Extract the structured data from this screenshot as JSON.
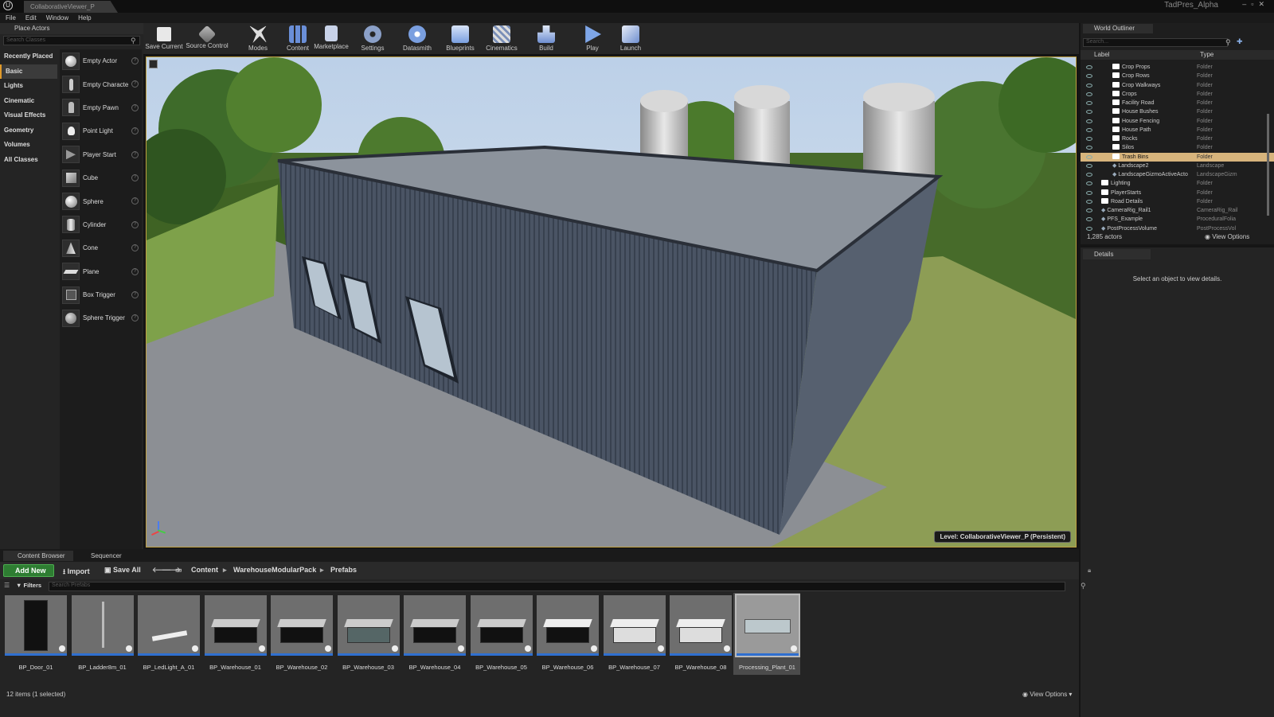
{
  "app": {
    "tab_title": "CollaborativeViewer_P",
    "project_name": "TadPres_Alpha"
  },
  "menu": [
    "File",
    "Edit",
    "Window",
    "Help"
  ],
  "place_actors": {
    "title": "Place Actors",
    "search_placeholder": "Search Classes",
    "categories": [
      "Recently Placed",
      "Basic",
      "Lights",
      "Cinematic",
      "Visual Effects",
      "Geometry",
      "Volumes",
      "All Classes"
    ],
    "selected_category": "Basic",
    "items": [
      "Empty Actor",
      "Empty Characte",
      "Empty Pawn",
      "Point Light",
      "Player Start",
      "Cube",
      "Sphere",
      "Cylinder",
      "Cone",
      "Plane",
      "Box Trigger",
      "Sphere Trigger"
    ]
  },
  "toolbar": {
    "buttons": [
      "Save Current",
      "Source Control",
      "Modes",
      "Content",
      "Marketplace",
      "Settings",
      "Datasmith",
      "Blueprints",
      "Cinematics",
      "Build",
      "Play",
      "Launch"
    ]
  },
  "viewport": {
    "level_label": "Level:  CollaborativeViewer_P (Persistent)"
  },
  "outliner": {
    "title": "World Outliner",
    "search_placeholder": "Search...",
    "col_label": "Label",
    "col_type": "Type",
    "rows": [
      {
        "name": "Crop Props",
        "type": "Folder",
        "indent": 2,
        "kind": "folder"
      },
      {
        "name": "Crop Rows",
        "type": "Folder",
        "indent": 2,
        "kind": "folder"
      },
      {
        "name": "Crop Walkways",
        "type": "Folder",
        "indent": 2,
        "kind": "folder"
      },
      {
        "name": "Crops",
        "type": "Folder",
        "indent": 2,
        "kind": "folder"
      },
      {
        "name": "Facility Road",
        "type": "Folder",
        "indent": 2,
        "kind": "folder"
      },
      {
        "name": "House Bushes",
        "type": "Folder",
        "indent": 2,
        "kind": "folder"
      },
      {
        "name": "House Fencing",
        "type": "Folder",
        "indent": 2,
        "kind": "folder"
      },
      {
        "name": "House Path",
        "type": "Folder",
        "indent": 2,
        "kind": "folder"
      },
      {
        "name": "Rocks",
        "type": "Folder",
        "indent": 2,
        "kind": "folder"
      },
      {
        "name": "Silos",
        "type": "Folder",
        "indent": 2,
        "kind": "folder"
      },
      {
        "name": "Trash Bins",
        "type": "Folder",
        "indent": 2,
        "kind": "folder",
        "selected": true
      },
      {
        "name": "Landscape2",
        "type": "Landscape",
        "indent": 2,
        "kind": "actor"
      },
      {
        "name": "LandscapeGizmoActiveActo",
        "type": "LandscapeGizm",
        "indent": 2,
        "kind": "actor"
      },
      {
        "name": "Lighting",
        "type": "Folder",
        "indent": 1,
        "kind": "folder"
      },
      {
        "name": "PlayerStarts",
        "type": "Folder",
        "indent": 1,
        "kind": "folder"
      },
      {
        "name": "Road Details",
        "type": "Folder",
        "indent": 1,
        "kind": "folder"
      },
      {
        "name": "CameraRig_Rail1",
        "type": "CameraRig_Rail",
        "indent": 1,
        "kind": "actor"
      },
      {
        "name": "PFS_Example",
        "type": "ProceduralFolia",
        "indent": 1,
        "kind": "actor"
      },
      {
        "name": "PostProcessVolume",
        "type": "PostProcessVol",
        "indent": 1,
        "kind": "actor"
      }
    ],
    "actor_count": "1,285 actors",
    "view_options": "View Options"
  },
  "details": {
    "title": "Details",
    "empty_message": "Select an object to view details."
  },
  "content_browser": {
    "tabs": [
      "Content Browser",
      "Sequencer"
    ],
    "add_new": "Add New",
    "import": "Import",
    "save_all": "Save All",
    "path": [
      "Content",
      "WarehouseModularPack",
      "Prefabs"
    ],
    "filters": "Filters",
    "search_placeholder": "Search Prefabs",
    "assets": [
      "BP_Door_01",
      "BP_Ladder8m_01",
      "BP_LedLight_A_01",
      "BP_Warehouse_01",
      "BP_Warehouse_02",
      "BP_Warehouse_03",
      "BP_Warehouse_04",
      "BP_Warehouse_05",
      "BP_Warehouse_06",
      "BP_Warehouse_07",
      "BP_Warehouse_08",
      "Processing_Plant_01"
    ],
    "selected_asset": "Processing_Plant_01",
    "status": "12 items (1 selected)",
    "view_options": "View Options"
  },
  "colors": {
    "accent": "#e09a2a",
    "selection": "#d7b47c",
    "add_new": "#2e7d32",
    "viewport_border": "#c0a040"
  }
}
